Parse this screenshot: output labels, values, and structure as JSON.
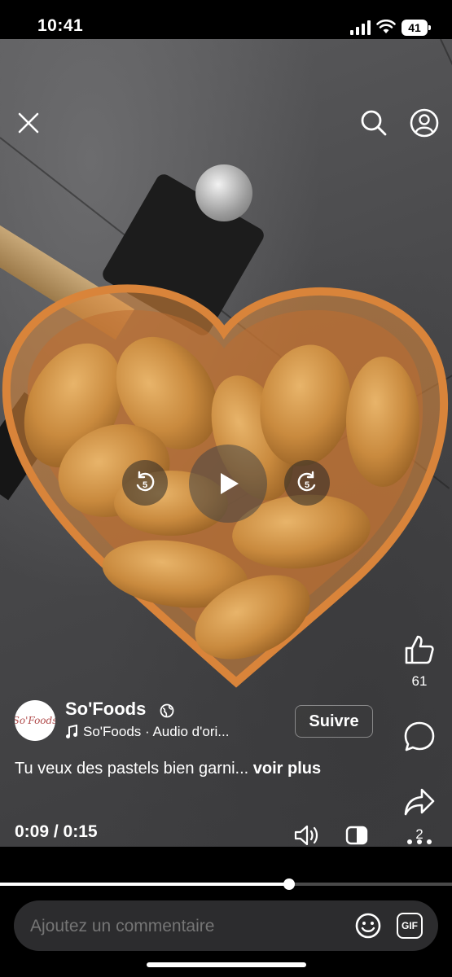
{
  "status_bar": {
    "time": "10:41",
    "battery": "41"
  },
  "video": {
    "controls": {
      "rewind_seconds": "5",
      "forward_seconds": "5"
    },
    "elapsed": "0:09 / 0:15",
    "progress_fraction": 0.64
  },
  "actions": {
    "like_count": "61",
    "share_count": "2"
  },
  "post": {
    "page_name": "So'Foods",
    "avatar_text": "So'Foods",
    "audio": "So'Foods · Audio d'ori...",
    "follow_label": "Suivre",
    "caption": "Tu veux des pastels bien garni...",
    "more_label": "voir plus"
  },
  "comment_bar": {
    "placeholder": "Ajoutez un commentaire",
    "gif_label": "GIF"
  },
  "colors": {
    "background": "#000000",
    "comment_bar": "#2c2c2e",
    "accent": "#ffffff"
  }
}
